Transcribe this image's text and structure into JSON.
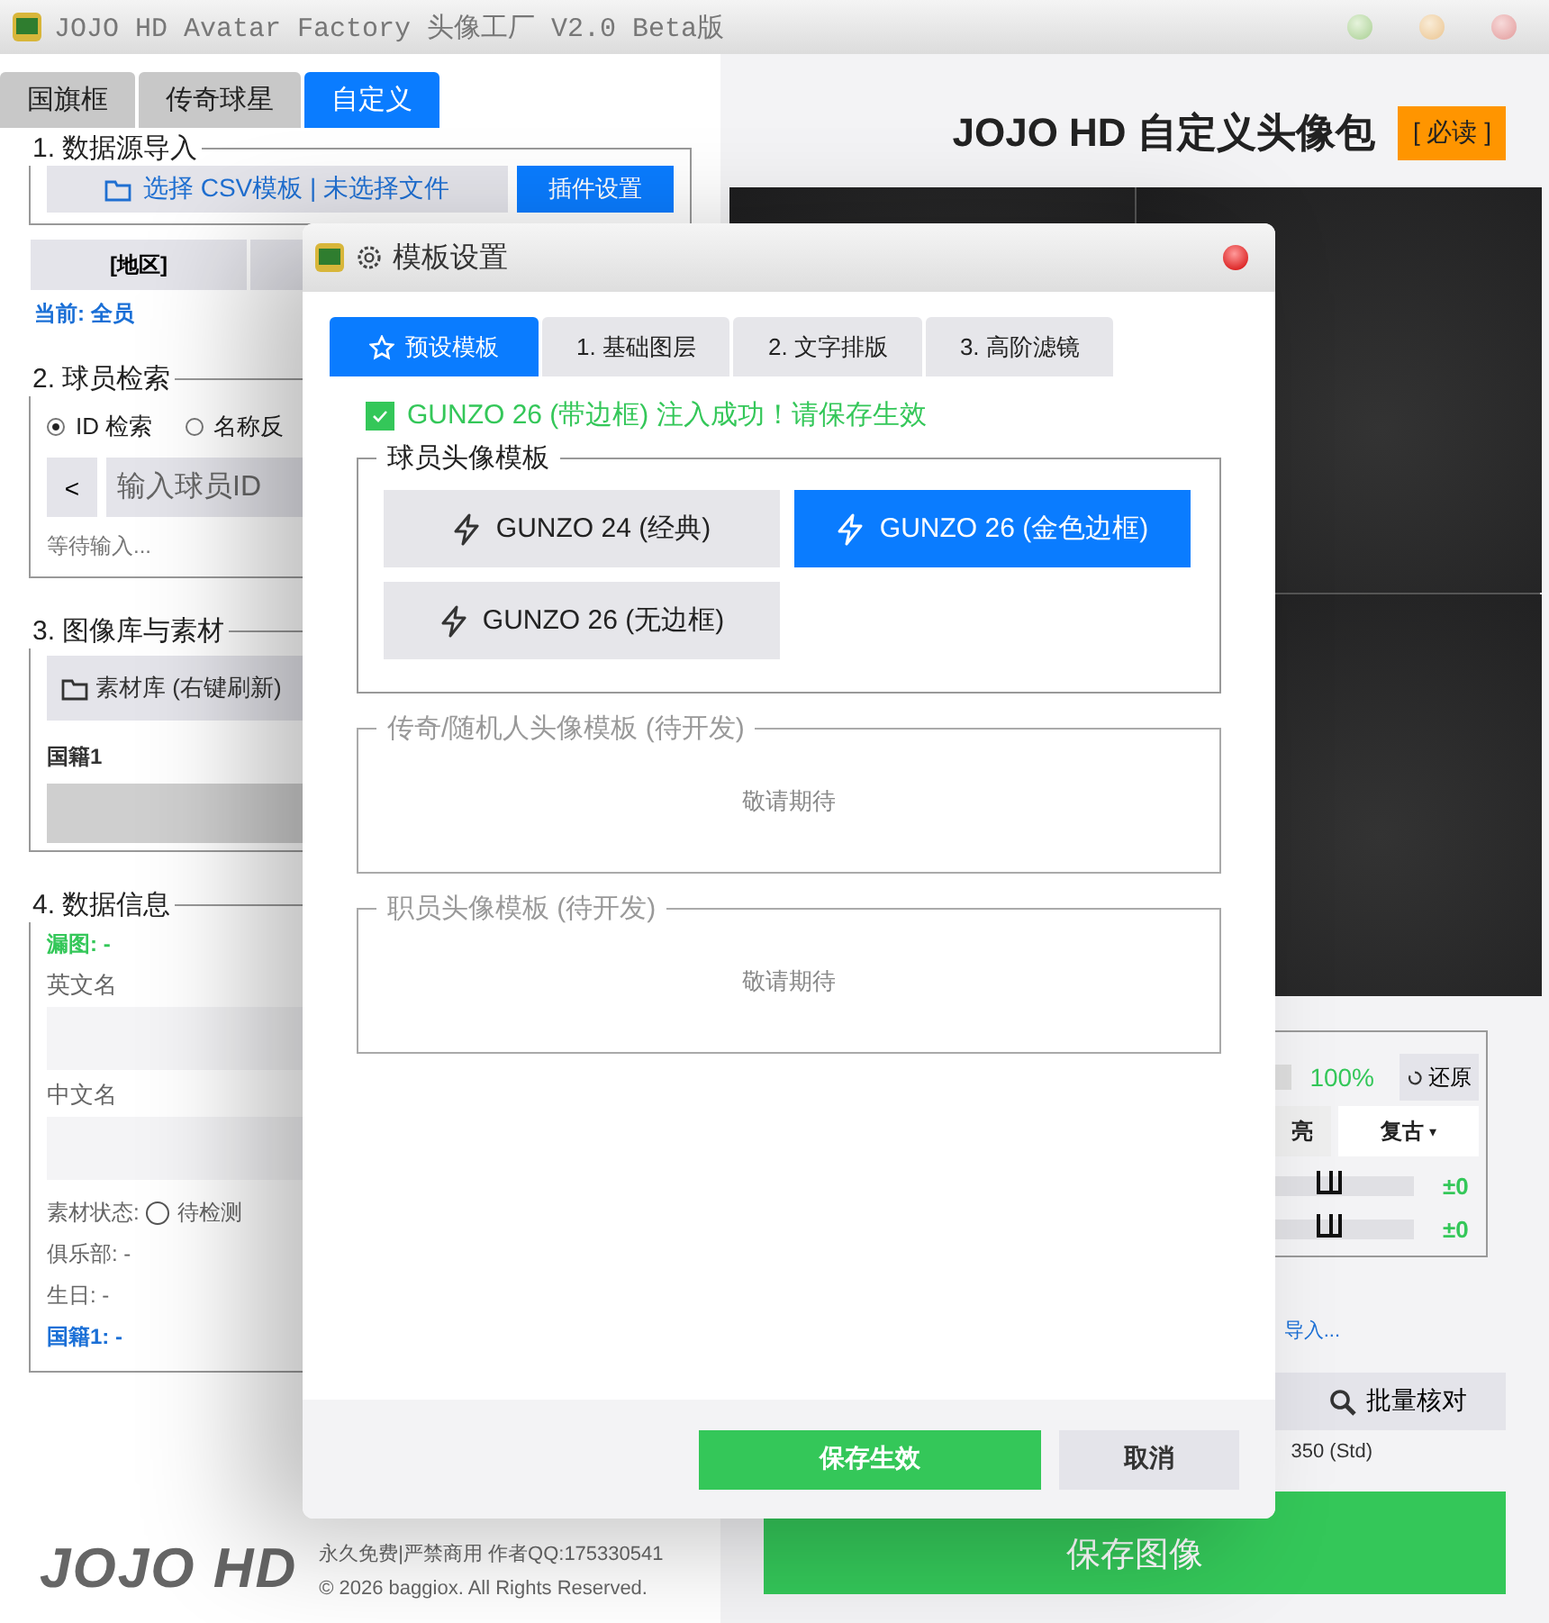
{
  "window": {
    "title": "JOJO HD Avatar Factory 头像工厂 V2.0 Beta版"
  },
  "main_tabs": [
    {
      "label": "国旗框",
      "selected": false
    },
    {
      "label": "传奇球星",
      "selected": false
    },
    {
      "label": "自定义",
      "selected": true
    }
  ],
  "source_group": {
    "title": "1. 数据源导入",
    "file_button": "选择 CSV模板 | 未选择文件",
    "plugin_button": "插件设置"
  },
  "region_button": "[地区]",
  "current": "当前: 全员",
  "search_group": {
    "title": "2. 球员检索",
    "modes": [
      {
        "label": "ID 检索",
        "selected": true
      },
      {
        "label": "名称反",
        "selected": false
      }
    ],
    "back_button": "<",
    "input": {
      "placeholder": "输入球员ID"
    },
    "status": "等待输入..."
  },
  "library_group": {
    "title": "3. 图像库与素材",
    "library_button": "素材库 (右键刷新)",
    "field_label": "国籍1"
  },
  "info_group": {
    "title": "4. 数据信息",
    "missing": "漏图:  -",
    "fields": [
      {
        "label": "英文名"
      },
      {
        "label": "中文名"
      }
    ],
    "asset_status": {
      "label": "素材状态:",
      "value": "待检测"
    },
    "lines": [
      {
        "text": "俱乐部: -",
        "kind": "plain"
      },
      {
        "text": "生日: -",
        "kind": "plain"
      },
      {
        "text": "国籍1: -",
        "kind": "link"
      }
    ]
  },
  "footer": {
    "logo": "JOJO HD",
    "notice": "永久免费|严禁商用 作者QQ:175330541",
    "copyright": "© 2026 baggiox. All Rights Reserved."
  },
  "header": {
    "title": "JOJO HD 自定义头像包",
    "badge": "[ 必读 ]"
  },
  "adjust_panel": {
    "zoom": "100%",
    "reset_button": "还原",
    "brightness": "亮",
    "style_dropdown": {
      "value": "复古",
      "caret": "▾"
    },
    "sliders": [
      {
        "level": 0.5,
        "reading": "±0"
      },
      {
        "level": 0.5,
        "reading": "±0"
      }
    ]
  },
  "import_link": "导入...",
  "batch_button": "批量核对",
  "size_note": "350 (Std)",
  "save_button": "保存图像",
  "dialog": {
    "title": "模板设置",
    "tabs": [
      {
        "label": "预设模板",
        "selected": true
      },
      {
        "label": "1. 基础图层",
        "selected": false
      },
      {
        "label": "2. 文字排版",
        "selected": false
      },
      {
        "label": "3. 高阶滤镜",
        "selected": false
      }
    ],
    "notice": {
      "checked": true,
      "text": "GUNZO 26 (带边框) 注入成功！请保存生效"
    },
    "groups": [
      {
        "title": "球员头像模板",
        "disabled": false,
        "templates": [
          {
            "label": "GUNZO 24 (经典)",
            "selected": false
          },
          {
            "label": "GUNZO 26 (金色边框)",
            "selected": true
          },
          {
            "label": "GUNZO 26 (无边框)",
            "selected": false
          }
        ]
      },
      {
        "title": "传奇/随机人头像模板 (待开发)",
        "disabled": true,
        "message": "敬请期待"
      },
      {
        "title": "职员头像模板 (待开发)",
        "disabled": true,
        "message": "敬请期待"
      }
    ],
    "buttons": [
      {
        "label": "保存生效",
        "kind": "primary"
      },
      {
        "label": "取消",
        "kind": "secondary"
      }
    ]
  }
}
